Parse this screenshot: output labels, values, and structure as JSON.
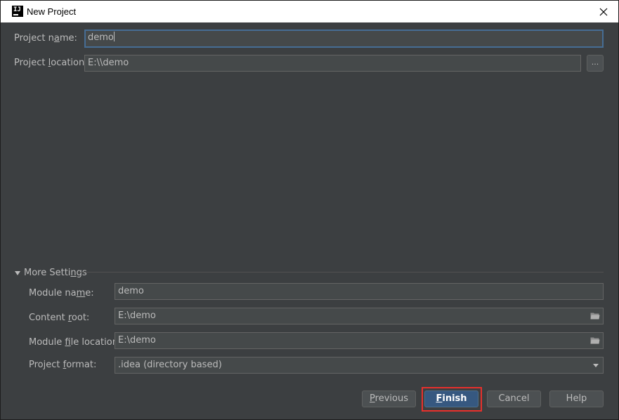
{
  "window": {
    "title": "New Project"
  },
  "form": {
    "project_name_label_pre": "Project n",
    "project_name_label_mn": "a",
    "project_name_label_post": "me:",
    "project_name_value": "demo",
    "project_location_label_pre": "Project ",
    "project_location_label_mn": "l",
    "project_location_label_post": "ocation:",
    "project_location_value": "E:\\\\demo",
    "browse_label": "..."
  },
  "more_settings": {
    "header_pre": "More Setti",
    "header_mn": "n",
    "header_post": "gs",
    "module_name_label_pre": "Module na",
    "module_name_label_mn": "m",
    "module_name_label_post": "e:",
    "module_name_value": "demo",
    "content_root_label_pre": "Content ",
    "content_root_label_mn": "r",
    "content_root_label_post": "oot:",
    "content_root_value": "E:\\demo",
    "module_file_location_label_pre": "Module ",
    "module_file_location_label_mn": "f",
    "module_file_location_label_post": "ile location:",
    "module_file_location_value": "E:\\demo",
    "project_format_label_pre": "Project ",
    "project_format_label_mn": "f",
    "project_format_label_post": "ormat:",
    "project_format_value": ".idea (directory based)"
  },
  "buttons": {
    "previous_mn": "P",
    "previous_rest": "revious",
    "finish_mn": "F",
    "finish_rest": "inish",
    "cancel": "Cancel",
    "help": "Help"
  },
  "colors": {
    "background": "#3c3f41",
    "field": "#45494a",
    "focus_border": "#466d94",
    "primary_button": "#365880",
    "highlight": "#e8302c"
  }
}
